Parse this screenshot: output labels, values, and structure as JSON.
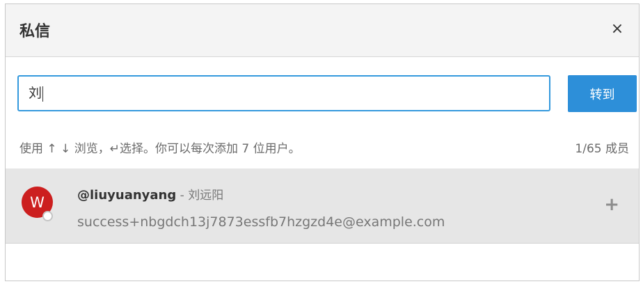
{
  "dialog": {
    "title": "私信",
    "close_icon": "×"
  },
  "search": {
    "value": "刘",
    "button_label": "转到"
  },
  "hint": {
    "text": "使用 ↑ ↓ 浏览，↵选择。你可以每次添加 7 位用户。",
    "member_count": "1/65 成员"
  },
  "results": [
    {
      "avatar_letter": "W",
      "avatar_color": "#cc1f1f",
      "username": "@liuyuanyang",
      "separator": " - ",
      "full_name": "刘远阳",
      "email": "success+nbgdch13j7873essfb7hzgzd4e@example.com",
      "add_icon": "+"
    }
  ],
  "colors": {
    "accent": "#2d8fd9",
    "input_border": "#3399dd",
    "selected_row": "#e6e6e6"
  }
}
